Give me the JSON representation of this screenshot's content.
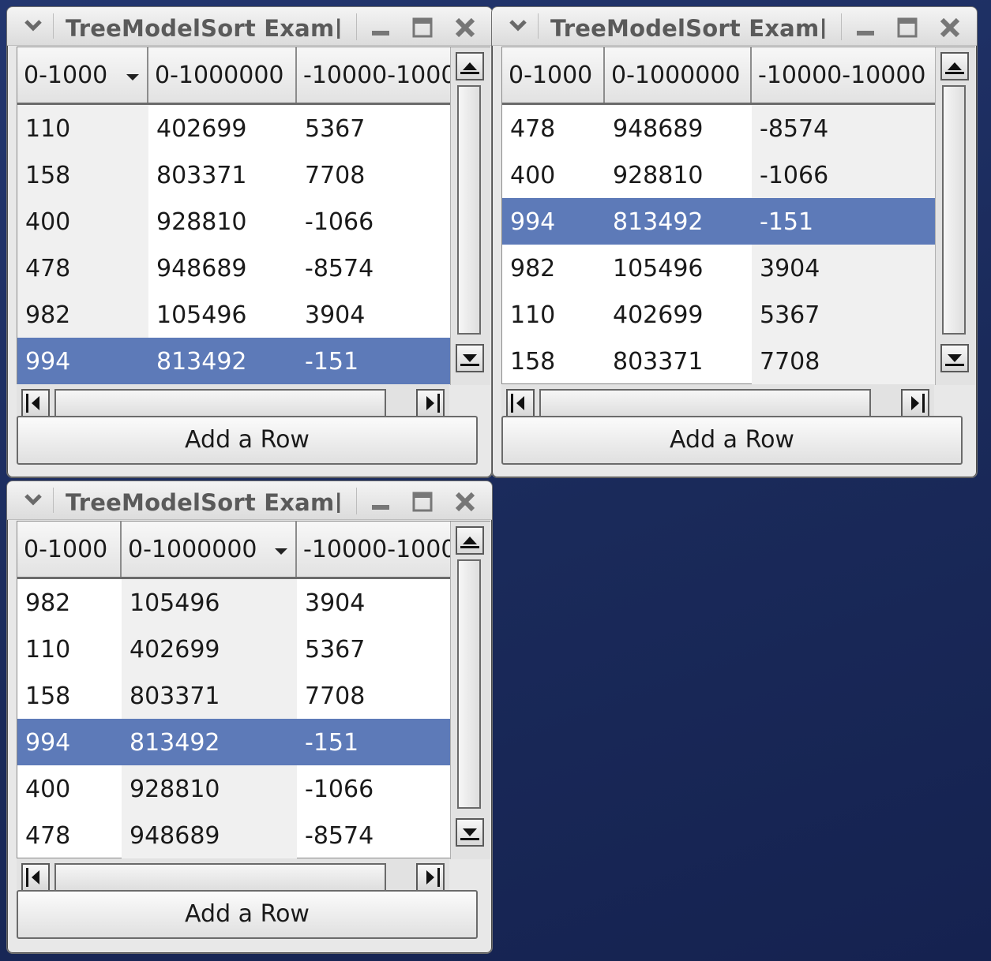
{
  "windows": [
    {
      "title": "TreeModelSort Exam|",
      "columns": [
        "0-1000",
        "0-1000000",
        "-10000-1000"
      ],
      "sort_column": 0,
      "rows": [
        [
          "110",
          "402699",
          "5367"
        ],
        [
          "158",
          "803371",
          "7708"
        ],
        [
          "400",
          "928810",
          "-1066"
        ],
        [
          "478",
          "948689",
          "-8574"
        ],
        [
          "982",
          "105496",
          "3904"
        ],
        [
          "994",
          "813492",
          "-151"
        ]
      ],
      "selected_row": 5,
      "button_label": "Add a Row"
    },
    {
      "title": "TreeModelSort Exam|",
      "columns": [
        "0-1000",
        "0-1000000",
        "-10000-10000"
      ],
      "sort_column": -1,
      "rows": [
        [
          "478",
          "948689",
          "-8574"
        ],
        [
          "400",
          "928810",
          "-1066"
        ],
        [
          "994",
          "813492",
          "-151"
        ],
        [
          "982",
          "105496",
          "3904"
        ],
        [
          "110",
          "402699",
          "5367"
        ],
        [
          "158",
          "803371",
          "7708"
        ]
      ],
      "selected_row": 2,
      "button_label": "Add a Row"
    },
    {
      "title": "TreeModelSort Exam|",
      "columns": [
        "0-1000",
        "0-1000000",
        "-10000-1000"
      ],
      "sort_column": 1,
      "rows": [
        [
          "982",
          "105496",
          "3904"
        ],
        [
          "110",
          "402699",
          "5367"
        ],
        [
          "158",
          "803371",
          "7708"
        ],
        [
          "994",
          "813492",
          "-151"
        ],
        [
          "400",
          "928810",
          "-1066"
        ],
        [
          "478",
          "948689",
          "-8574"
        ]
      ],
      "selected_row": 3,
      "button_label": "Add a Row"
    }
  ],
  "colors": {
    "selection": "#5d7ab8",
    "desktop": "#1d2d60"
  }
}
